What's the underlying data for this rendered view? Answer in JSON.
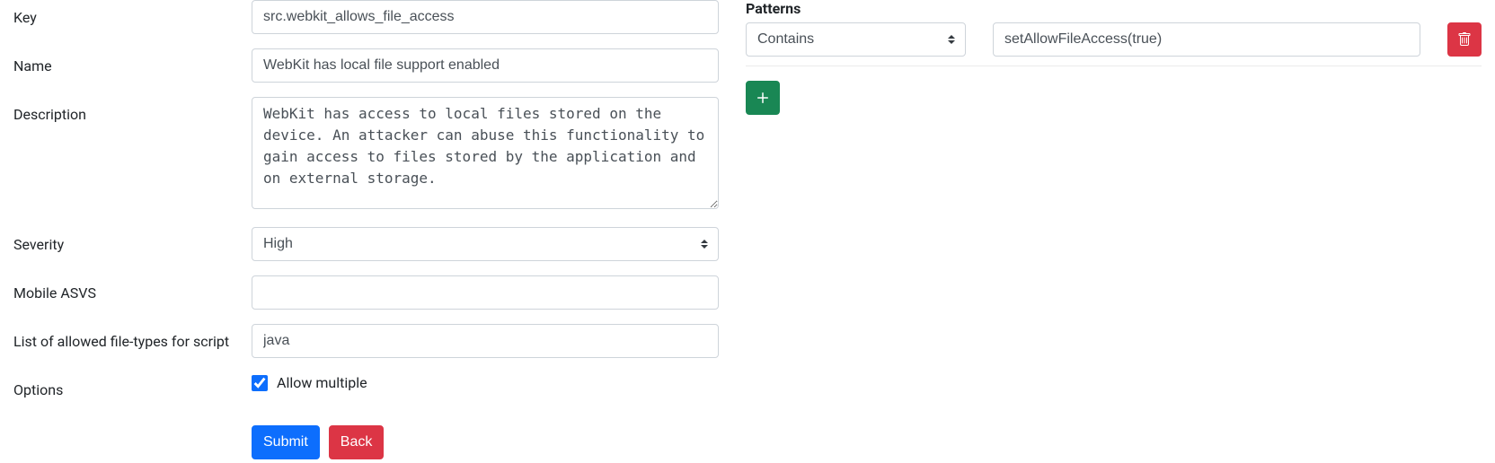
{
  "form": {
    "labels": {
      "key": "Key",
      "name": "Name",
      "description": "Description",
      "severity": "Severity",
      "mobile_asvs": "Mobile ASVS",
      "file_types": "List of allowed file-types for script",
      "options": "Options"
    },
    "values": {
      "key": "src.webkit_allows_file_access",
      "name": "WebKit has local file support enabled",
      "description": "WebKit has access to local files stored on the device. An attacker can abuse this functionality to gain access to files stored by the application and on external storage.",
      "severity": "High",
      "mobile_asvs": "",
      "file_types": "java"
    },
    "allow_multiple_label": "Allow multiple",
    "submit_label": "Submit",
    "back_label": "Back"
  },
  "patterns": {
    "header": "Patterns",
    "rows": [
      {
        "type": "Contains",
        "value": "setAllowFileAccess(true)"
      }
    ]
  }
}
